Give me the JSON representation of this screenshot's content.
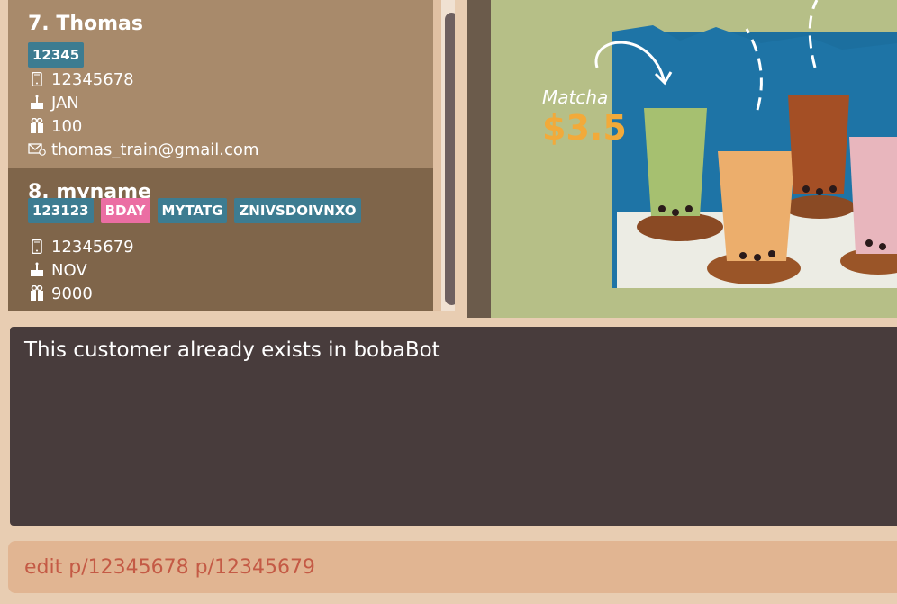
{
  "customers": [
    {
      "title": "7.  Thomas",
      "tags": [
        {
          "label": "12345",
          "color": "#3d7c91"
        }
      ],
      "phone": "12345678",
      "birthday": "JAN",
      "reward": "100",
      "email": "thomas_train@gmail.com"
    },
    {
      "title": "8.  myname",
      "tags": [
        {
          "label": "123123",
          "color": "#3d7c91"
        },
        {
          "label": "BDAY",
          "color": "#eb6ea3"
        },
        {
          "label": "MYTATG",
          "color": "#3d7c91"
        },
        {
          "label": "ZNIVSDOIVNXO",
          "color": "#3d7c91"
        }
      ],
      "phone": "12345679",
      "birthday": "NOV",
      "reward": "9000"
    }
  ],
  "poster": {
    "item_name": "Matcha",
    "item_price": "$3.5"
  },
  "result": {
    "message": "This customer already exists in bobaBot"
  },
  "command": {
    "value": "edit p/12345678 p/12345679"
  },
  "icons": {
    "phone": "phone-icon",
    "birthday": "cake-icon",
    "reward": "gift-icon",
    "email": "email-icon"
  }
}
